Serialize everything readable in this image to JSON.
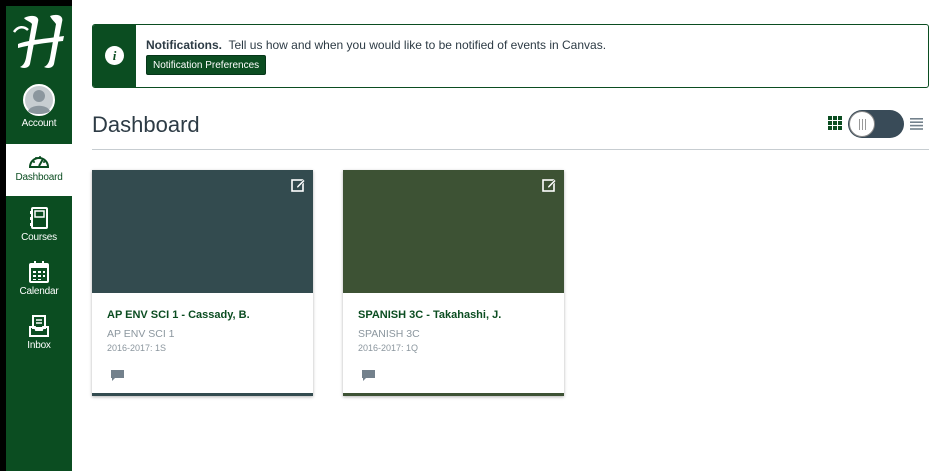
{
  "nav": {
    "account": "Account",
    "dashboard": "Dashboard",
    "courses": "Courses",
    "calendar": "Calendar",
    "inbox": "Inbox"
  },
  "notification": {
    "title": "Notifications.",
    "message": "Tell us how and when you would like to be notified of events in Canvas.",
    "button": "Notification Preferences"
  },
  "header": {
    "title": "Dashboard"
  },
  "courses": [
    {
      "name": "AP ENV SCI 1 - Cassady, B.",
      "code": "AP ENV SCI 1",
      "term": "2016-2017: 1S",
      "color": "#334b4f"
    },
    {
      "name": "SPANISH 3C - Takahashi, J.",
      "code": "SPANISH 3C",
      "term": "2016-2017: 1Q",
      "color": "#3d5234"
    }
  ],
  "theme": {
    "brand": "#0b4d21",
    "text": "#2d3b45"
  }
}
